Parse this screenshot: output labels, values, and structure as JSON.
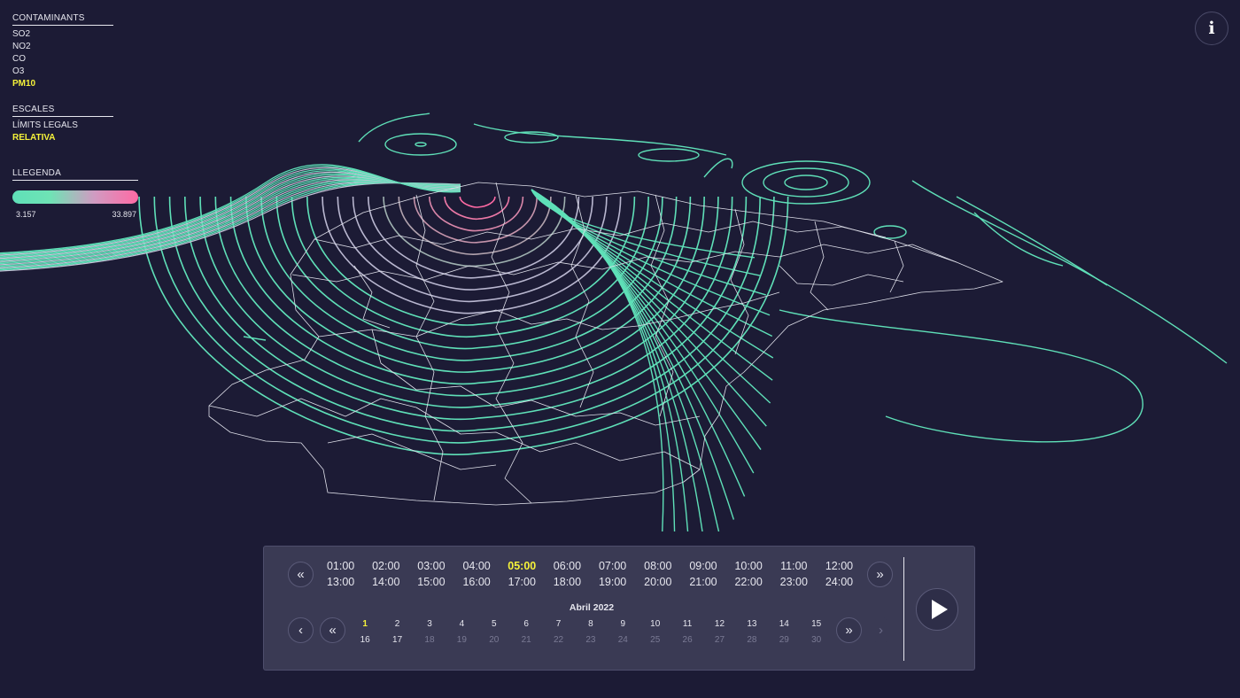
{
  "pollutants": {
    "heading": "CONTAMINANTS",
    "items": [
      "SO2",
      "NO2",
      "CO",
      "O3",
      "PM10"
    ],
    "active": "PM10"
  },
  "scales": {
    "heading": "ESCALES",
    "items": [
      "LÍMITS LEGALS",
      "RELATIVA"
    ],
    "active": "RELATIVA"
  },
  "legend": {
    "heading": "LLEGENDA",
    "min": "3.157",
    "max": "33.897",
    "color_low": "#5fe0b8",
    "color_high": "#ff6aa4"
  },
  "info_button": {
    "glyph": "i"
  },
  "time": {
    "hours_top": [
      "01:00",
      "02:00",
      "03:00",
      "04:00",
      "05:00",
      "06:00",
      "07:00",
      "08:00",
      "09:00",
      "10:00",
      "11:00",
      "12:00"
    ],
    "hours_bottom": [
      "13:00",
      "14:00",
      "15:00",
      "16:00",
      "17:00",
      "18:00",
      "19:00",
      "20:00",
      "21:00",
      "22:00",
      "23:00",
      "24:00"
    ],
    "active_hour": "05:00",
    "prev_icon": "«",
    "next_icon": "»"
  },
  "calendar": {
    "month": "Abril 2022",
    "days_top": [
      "1",
      "2",
      "3",
      "4",
      "5",
      "6",
      "7",
      "8",
      "9",
      "10",
      "11",
      "12",
      "13",
      "14",
      "15"
    ],
    "days_bottom": [
      "16",
      "17",
      "18",
      "19",
      "20",
      "21",
      "22",
      "23",
      "24",
      "25",
      "26",
      "27",
      "28",
      "29",
      "30"
    ],
    "active_day": "1",
    "enabled_through": 17,
    "prev_month_icon": "‹",
    "next_month_icon": "›"
  },
  "play_icon": "play-icon",
  "accent": "#f5f23a",
  "background": "#1c1b35"
}
